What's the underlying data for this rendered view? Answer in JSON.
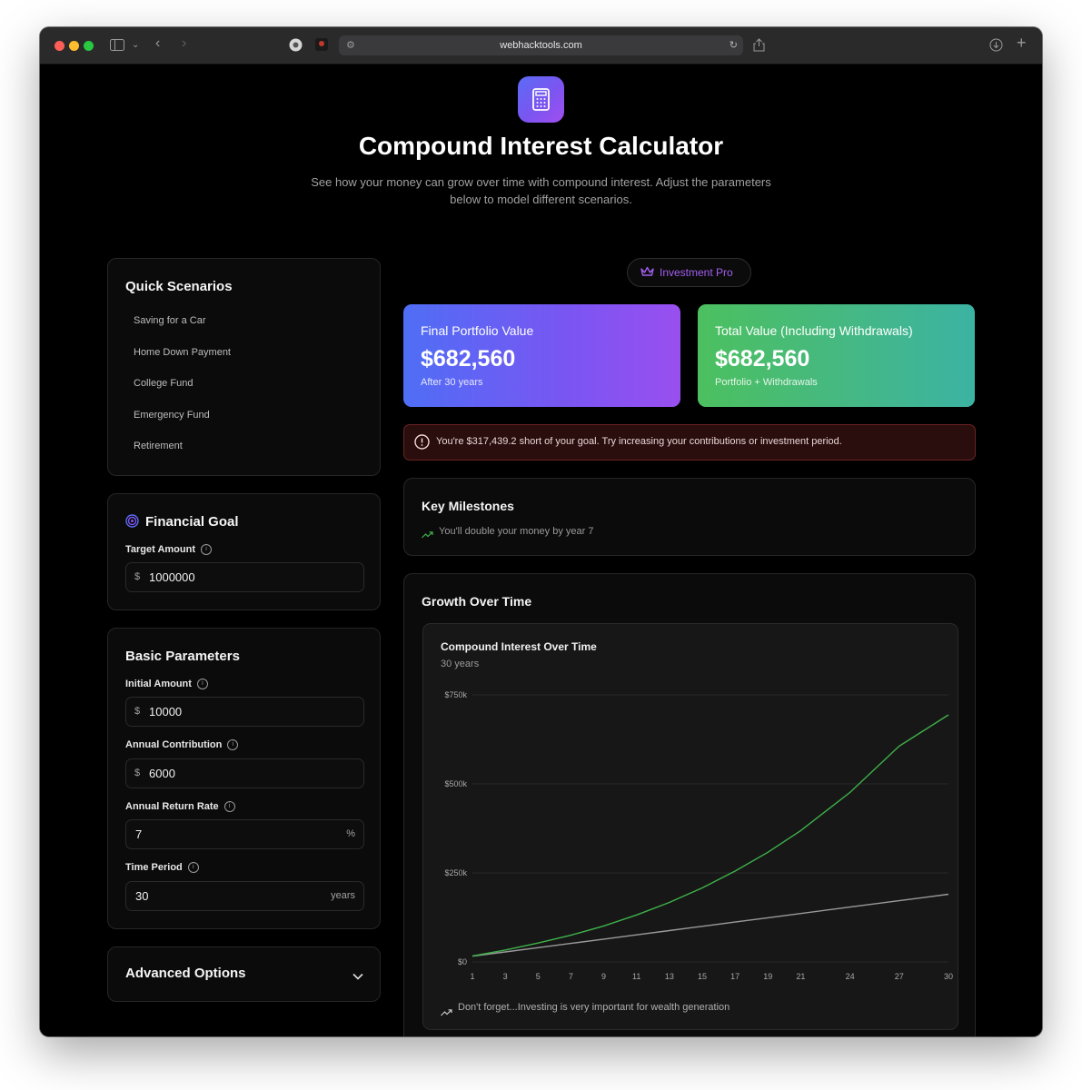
{
  "browser": {
    "url": "webhacktools.com",
    "colors": {
      "close": "#ff5f57",
      "minimize": "#febc2e",
      "zoom": "#28c840"
    }
  },
  "header": {
    "title": "Compound Interest Calculator",
    "subtitle": "See how your money can grow over time with compound interest. Adjust the parameters below to model different scenarios."
  },
  "quick_scenarios": {
    "title": "Quick Scenarios",
    "items": [
      "Saving for a Car",
      "Home Down Payment",
      "College Fund",
      "Emergency Fund",
      "Retirement"
    ]
  },
  "financial_goal": {
    "title": "Financial Goal",
    "target_label": "Target Amount",
    "target_prefix": "$",
    "target_value": "1000000"
  },
  "basic_parameters": {
    "title": "Basic Parameters",
    "initial_label": "Initial Amount",
    "initial_prefix": "$",
    "initial_value": "10000",
    "contribution_label": "Annual Contribution",
    "contribution_prefix": "$",
    "contribution_value": "6000",
    "rate_label": "Annual Return Rate",
    "rate_value": "7",
    "rate_suffix": "%",
    "period_label": "Time Period",
    "period_value": "30",
    "period_suffix": "years"
  },
  "advanced": {
    "title": "Advanced Options"
  },
  "badge": {
    "label": "Investment Pro",
    "color": "#a35ef0"
  },
  "stats": {
    "final": {
      "label": "Final Portfolio Value",
      "value": "$682,560",
      "sub": "After 30 years"
    },
    "total": {
      "label": "Total Value (Including Withdrawals)",
      "value": "$682,560",
      "sub": "Portfolio + Withdrawals"
    }
  },
  "alert": {
    "text": "You're $317,439.2 short of your goal. Try increasing your contributions or investment period."
  },
  "milestones": {
    "title": "Key Milestones",
    "items": [
      "You'll double your money by year 7"
    ]
  },
  "growth": {
    "title": "Growth Over Time",
    "chart_title": "Compound Interest Over Time",
    "chart_subtitle": "30 years",
    "footer": "Don't forget...Investing is very important for wealth generation"
  },
  "chart_data": {
    "type": "line",
    "title": "Compound Interest Over Time",
    "subtitle": "30 years",
    "xlabel": "",
    "ylabel": "",
    "ylim": [
      0,
      750000
    ],
    "yticks": [
      0,
      250000,
      500000,
      750000
    ],
    "ytick_labels": [
      "$0",
      "$250k",
      "$500k",
      "$750k"
    ],
    "xtick_labels": [
      "1",
      "3",
      "5",
      "7",
      "9",
      "11",
      "13",
      "15",
      "17",
      "19",
      "21",
      "24",
      "27",
      "30"
    ],
    "grid": true,
    "series": [
      {
        "color": "#3fb24a",
        "x": [
          1,
          3,
          5,
          7,
          9,
          11,
          13,
          15,
          17,
          19,
          21,
          24,
          27,
          30
        ],
        "values": [
          16700,
          33500,
          53000,
          75000,
          101000,
          132000,
          167000,
          208000,
          255000,
          308000,
          369000,
          476000,
          606000,
          694000
        ]
      },
      {
        "color": "#9a9a9a",
        "x": [
          1,
          3,
          5,
          7,
          9,
          11,
          13,
          15,
          17,
          19,
          21,
          24,
          27,
          30
        ],
        "values": [
          16000,
          28000,
          40000,
          52000,
          64000,
          76000,
          88000,
          100000,
          112000,
          124000,
          136000,
          154000,
          172000,
          190000
        ]
      }
    ]
  }
}
